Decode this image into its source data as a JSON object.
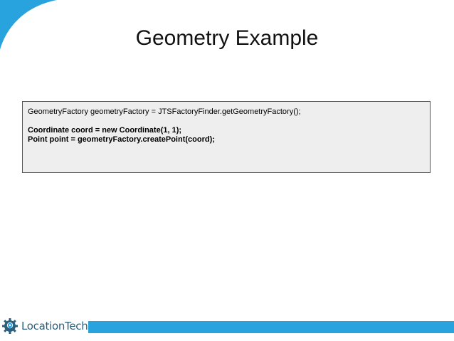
{
  "slide": {
    "title": "Geometry Example"
  },
  "code_box": {
    "lines": [
      "GeometryFactory geometryFactory = JTSFactoryFinder.getGeometryFactory();",
      "Coordinate coord = new Coordinate(1, 1);",
      "Point point = geometryFactory.createPoint(coord);"
    ]
  },
  "footer": {
    "logo_text": "LocationTech",
    "logo_icon": "gear-location-icon",
    "bar_color": "#29a3dd"
  },
  "colors": {
    "accent": "#29a3dd",
    "code_background": "#eeeeee"
  }
}
